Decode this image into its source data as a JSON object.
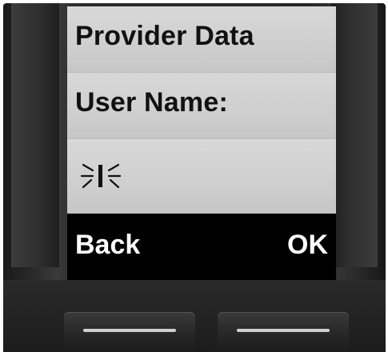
{
  "screen": {
    "title": "Provider Data",
    "field_label": "User Name:",
    "field_value": ""
  },
  "softkeys": {
    "left_label": "Back",
    "right_label": "OK"
  },
  "icons": {
    "cursor": "blinking-text-cursor-icon",
    "left_key": "left-softkey-bar",
    "right_key": "right-softkey-bar"
  },
  "colors": {
    "screen_bg": "#cfcfcf",
    "softbar_bg": "#000000",
    "text_dark": "#111111",
    "text_light": "#ffffff"
  }
}
